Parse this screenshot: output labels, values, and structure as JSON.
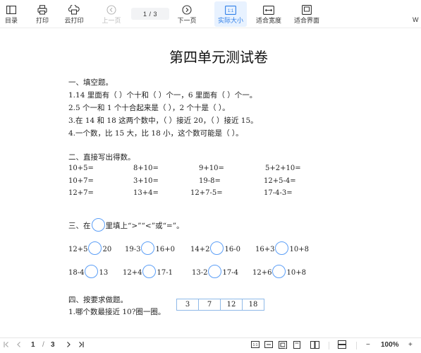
{
  "toolbar": {
    "toc": "目录",
    "print": "打印",
    "cloud_print": "云打印",
    "prev_page": "上一页",
    "page_indicator": "1 / 3",
    "next_page": "下一页",
    "actual_size": "实际大小",
    "fit_width": "适合宽度",
    "fit_page": "适合界面",
    "cut_text": "W"
  },
  "document": {
    "title": "第四单元测试卷",
    "section1": {
      "heading": "一、填空题。",
      "q1": "1.14 里面有（    ）个十和（    ）个一，6 里面有（    ）个一。",
      "q2": "2.5 个一和 1 个十合起来是（    ），2 个十是（    ）。",
      "q3": "3.在 14 和 18 这两个数中，（    ）接近 20，（    ）接近 15。",
      "q4": "4.一个数，比 15 大，比 18 小，这个数可能是（    ）。"
    },
    "section2": {
      "heading": "二、直接写出得数。",
      "rows": [
        [
          "10+5=",
          "8+10=",
          "9+10=",
          "5+2+10="
        ],
        [
          "10+7=",
          "3+10=",
          "19-8=",
          "12+5-4="
        ],
        [
          "12+7=",
          "13+4=",
          "12+7-5=",
          "17-4-3="
        ]
      ]
    },
    "section3": {
      "heading_pre": "三、在",
      "heading_post": "里填上“>”“<”或“=”。",
      "rows": [
        [
          [
            "12+5",
            "20"
          ],
          [
            "19-3",
            "16+0"
          ],
          [
            "14+2",
            "16-0"
          ],
          [
            "16+3",
            "10+8"
          ]
        ],
        [
          [
            "18-4",
            "13"
          ],
          [
            "12+4",
            "17-1"
          ],
          [
            "13-2",
            "17-4"
          ],
          [
            "12+6",
            "10+8"
          ]
        ]
      ]
    },
    "section4": {
      "heading": "四、按要求做题。",
      "q1": "1.哪个数最接近 10?圈一圈。",
      "numbers": [
        "3",
        "7",
        "12",
        "18"
      ]
    }
  },
  "statusbar": {
    "current_page": "1",
    "separator": "/",
    "total_pages": "3",
    "zoom": "100%",
    "zoom_out": "−",
    "zoom_in": "+"
  },
  "colors": {
    "accent": "#2f7fe8",
    "active_bg": "#e8f2ff",
    "circle": "#5b9ef7",
    "table_border": "#8fb9e8"
  }
}
